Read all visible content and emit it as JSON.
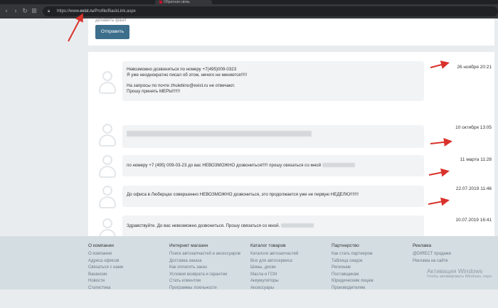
{
  "browser": {
    "tab_title": "Обратная связь",
    "url_prefix": "https://www.",
    "url_domain": "exist.ru",
    "url_path": "/Profile/BackLink.aspx",
    "nav_icons": [
      "back-icon",
      "forward-icon",
      "reload-icon",
      "apps-icon"
    ]
  },
  "form": {
    "attach_label": "Добавить файл",
    "send_label": "Отправить"
  },
  "messages": [
    {
      "lines": [
        "Невозможно дозвониться по номеру +7(495)009-0323",
        "Я уже неоднократно писал об этом, нечего не меняется!!!!!",
        "",
        "На запросы по почте zhulebino@exist.ru не отвечают.",
        "Прошу принять МЕРЫ!!!!!!"
      ],
      "date": "26 ноября 20:21"
    },
    {
      "lines": [
        ""
      ],
      "date": "10 октября 13:05"
    },
    {
      "lines": [
        "по номеру +7 (495) 009-03-23 до вас НЕВОЗМОЖНО дозвониться!!!!! прошу связаться со мной"
      ],
      "date": "11 марта 11:28"
    },
    {
      "lines": [
        "До офиса в Люберцах совершенно НЕВОЗМОЖНО дозвониться, это продолжается уже не первую НЕДЕЛЮ!!!!!!!"
      ],
      "date": "22.07.2019 11:46"
    },
    {
      "lines": [
        "Здравствуйте. До вас невозможно дозвониться. Прошу связаться со мной."
      ],
      "date": "10.07.2019 16:41"
    }
  ],
  "footer": {
    "columns": [
      {
        "title": "О компании",
        "links": [
          "О компании",
          "Адреса офисов",
          "Связаться с нами",
          "Вакансии",
          "Новости",
          "Статистика"
        ]
      },
      {
        "title": "Интернет магазин",
        "links": [
          "Поиск автозапчастей и аксессуаров",
          "Доставка заказа",
          "Как оплатить заказ",
          "Условия возврата и гарантии",
          "Стать клиентом",
          "Программы лояльности"
        ]
      },
      {
        "title": "Каталог товаров",
        "links": [
          "Каталоги автозапчастей",
          "Все для автосервиса",
          "Шины, диски",
          "Масла и ГСМ",
          "Аккумуляторы",
          "Аксессуары"
        ]
      },
      {
        "title": "Партнерство",
        "links": [
          "Как стать партнером",
          "Таблица скидок",
          "Регионам",
          "Поставщикам",
          "Юридическим лицам",
          "Производителям"
        ]
      },
      {
        "title": "Реклама",
        "links": [
          "@DIRECT продажи",
          "Реклама на сайте"
        ]
      }
    ],
    "watermark_title": "Активация Windows",
    "watermark_sub": "Чтобы активировать Windows, пере"
  },
  "colors": {
    "accent": "#3d6e8c",
    "annotation_arrow": "#d9322b"
  }
}
